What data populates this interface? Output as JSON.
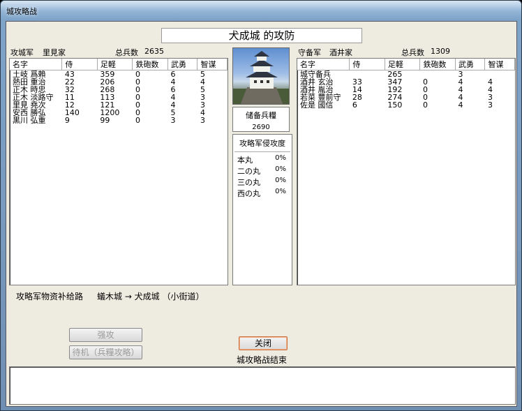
{
  "window": {
    "title": "城攻略战"
  },
  "battle_title": "犬成城 的攻防",
  "attacker": {
    "label": "攻城军",
    "clan": "里見家",
    "total_label": "总兵数",
    "total": "2635",
    "columns": [
      "名字",
      "侍",
      "足軽",
      "鉄砲数",
      "武勇",
      "智谋"
    ],
    "rows": [
      [
        "土岐 爲賴",
        "43",
        "359",
        "0",
        "6",
        "5"
      ],
      [
        "熱田 重治",
        "22",
        "206",
        "0",
        "4",
        "4"
      ],
      [
        "正木 時忠",
        "32",
        "268",
        "0",
        "6",
        "5"
      ],
      [
        "正木 淡路守",
        "11",
        "113",
        "0",
        "4",
        "3"
      ],
      [
        "里見 堯次",
        "12",
        "121",
        "0",
        "4",
        "3"
      ],
      [
        "安西 勝弘",
        "140",
        "1200",
        "0",
        "5",
        "4"
      ],
      [
        "黒川 弘重",
        "9",
        "99",
        "0",
        "3",
        "3"
      ]
    ]
  },
  "defender": {
    "label": "守备军",
    "clan": "酒井家",
    "total_label": "总兵数",
    "total": "1309",
    "columns": [
      "名字",
      "侍",
      "足軽",
      "鉄砲数",
      "武勇",
      "智谋"
    ],
    "rows": [
      [
        "城守备兵",
        "",
        "265",
        "",
        "3",
        ""
      ],
      [
        "酒井 玄治",
        "33",
        "347",
        "0",
        "4",
        "4"
      ],
      [
        "酒井 胤治",
        "14",
        "192",
        "0",
        "4",
        "4"
      ],
      [
        "若菜 豐前守",
        "28",
        "274",
        "0",
        "4",
        "3"
      ],
      [
        "佐是 國信",
        "6",
        "150",
        "0",
        "4",
        "3"
      ]
    ]
  },
  "reserve": {
    "label": "储备兵糧",
    "value": "2690"
  },
  "invasion": {
    "label": "攻略军侵攻度",
    "items": [
      {
        "name": "本丸",
        "value": "0%"
      },
      {
        "name": "二の丸",
        "value": "0%"
      },
      {
        "name": "三の丸",
        "value": "0%"
      },
      {
        "name": "西の丸",
        "value": "0%"
      }
    ]
  },
  "supply": {
    "label": "攻略军物资补给路",
    "route": "蟻木城 → 犬成城 （小街道）"
  },
  "buttons": {
    "assault": "强攻",
    "wait": "待机（兵糧攻略）",
    "close": "关闭"
  },
  "status": "城攻略战结束"
}
